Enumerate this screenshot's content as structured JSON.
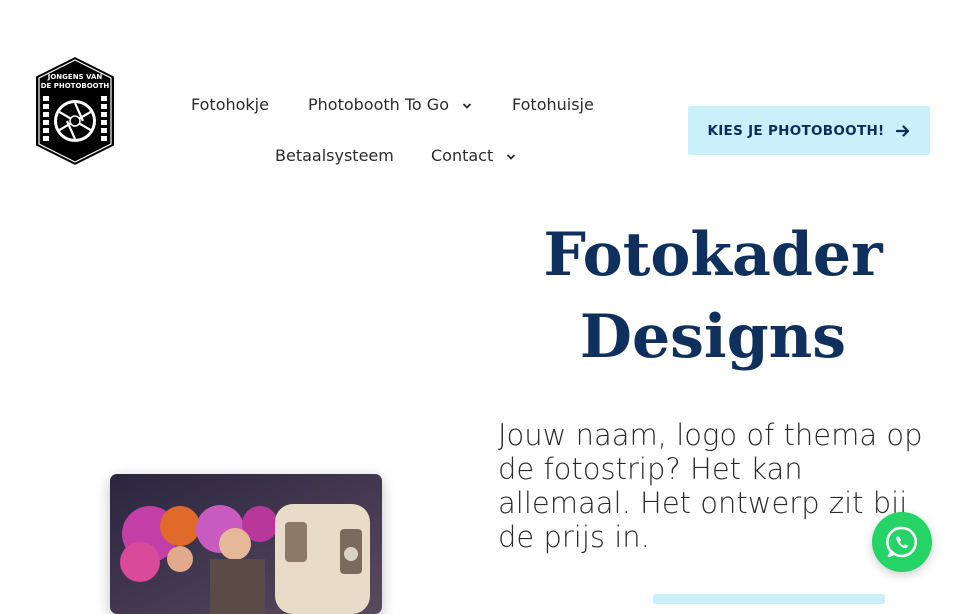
{
  "brand": {
    "logo_line1": "JONGENS VAN",
    "logo_line2": "DE PHOTOBOOTH",
    "logo_icon": "aperture-icon"
  },
  "nav": {
    "items": [
      {
        "label": "Fotohokje",
        "has_dropdown": false
      },
      {
        "label": "Photobooth To Go",
        "has_dropdown": true
      },
      {
        "label": "Fotohuisje",
        "has_dropdown": false
      },
      {
        "label": "Betaalsysteem",
        "has_dropdown": false
      },
      {
        "label": "Contact",
        "has_dropdown": true
      }
    ]
  },
  "cta": {
    "label": "KIES JE PHOTOBOOTH!",
    "icon": "arrow-right-icon",
    "color": "#c9f0fb"
  },
  "hero": {
    "title_line1": "Fotokader",
    "title_line2": "Designs",
    "text": "Jouw naam, logo of thema op de fotostrip? Het kan allemaal. Het ontwerp zit bij de prijs in."
  },
  "colors": {
    "title": "#0f2f5c",
    "accent": "#c9f0fb",
    "whatsapp": "#25d366"
  },
  "widgets": {
    "whatsapp_icon": "whatsapp-icon"
  }
}
